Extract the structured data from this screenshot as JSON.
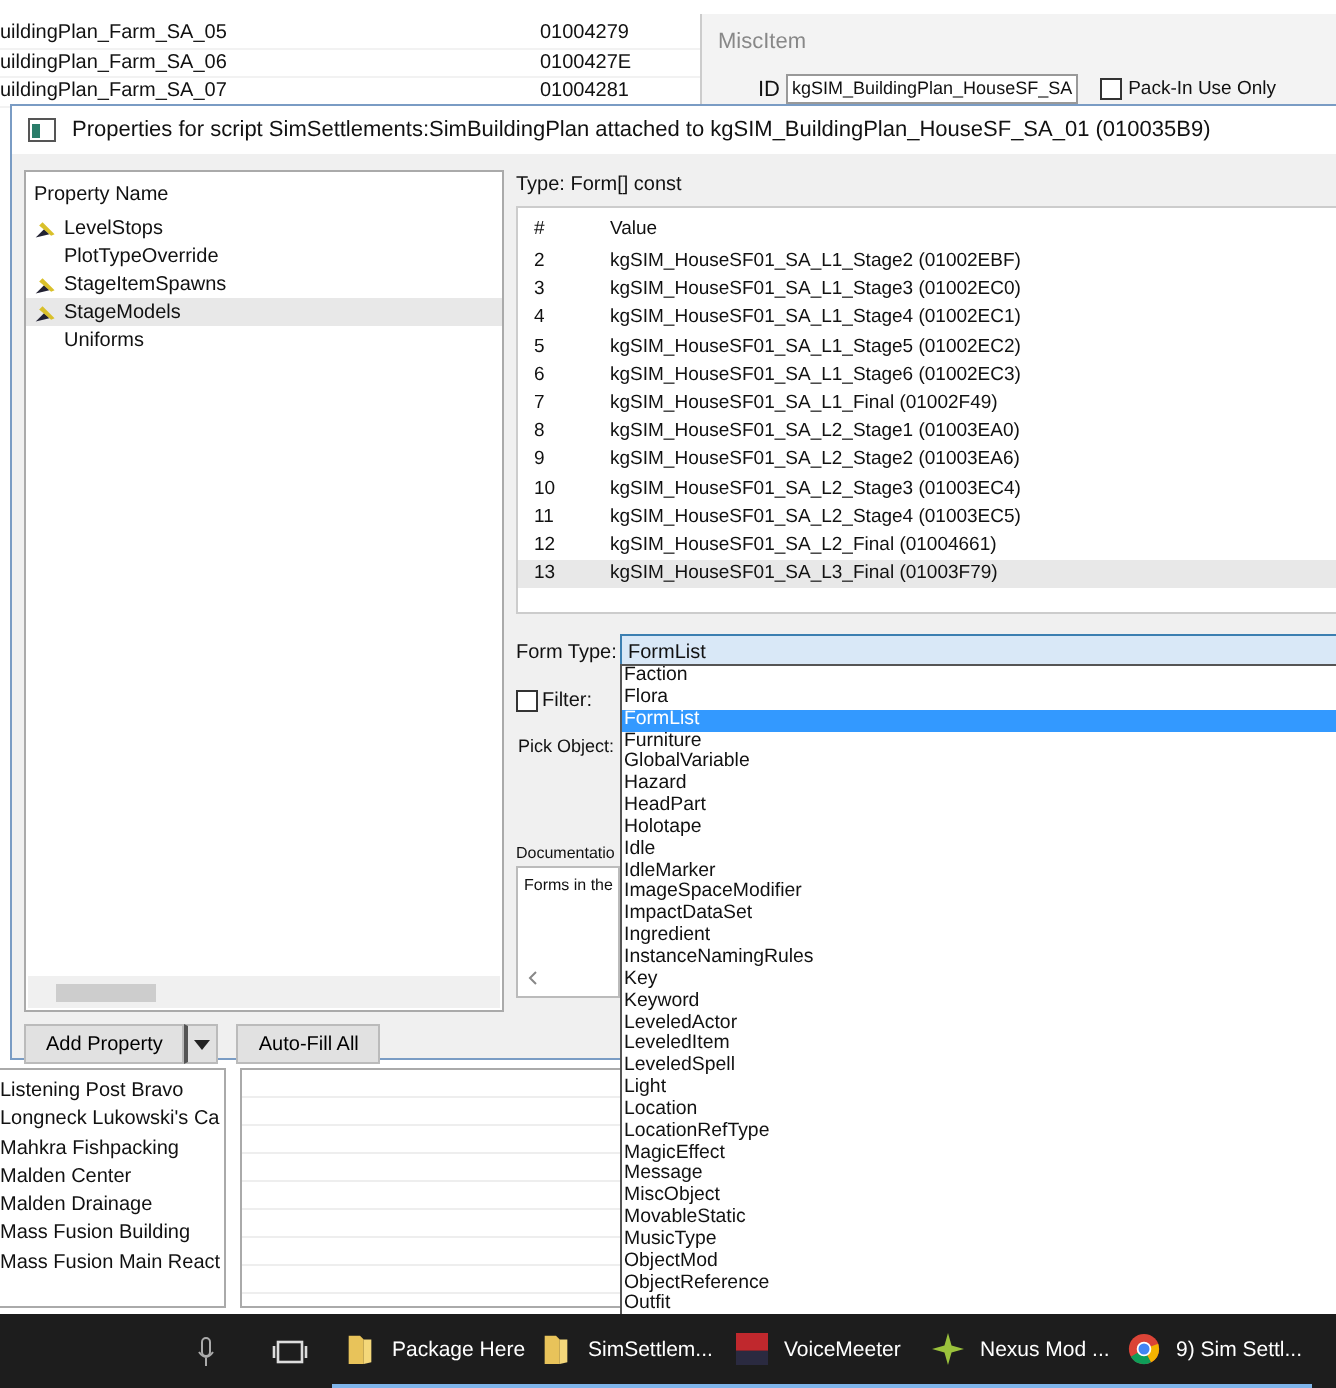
{
  "back_list": {
    "rows": [
      {
        "name": "uildingPlan_Farm_SA_05",
        "form_id": "01004279"
      },
      {
        "name": "uildingPlan_Farm_SA_06",
        "form_id": "0100427E"
      },
      {
        "name": "uildingPlan_Farm_SA_07",
        "form_id": "01004281"
      }
    ]
  },
  "misc_item": {
    "title": "MiscItem",
    "id_label": "ID",
    "id_value": "kgSIM_BuildingPlan_HouseSF_SA",
    "pack_in": {
      "label": "Pack-In Use Only",
      "checked": false
    }
  },
  "dialog": {
    "title": "Properties for script SimSettlements:SimBuildingPlan attached to kgSIM_BuildingPlan_HouseSF_SA_01 (010035B9)",
    "property_list": {
      "header": "Property Name",
      "items": [
        {
          "label": "LevelStops",
          "icon": true,
          "selected": false
        },
        {
          "label": "PlotTypeOverride",
          "icon": false,
          "selected": false
        },
        {
          "label": "StageItemSpawns",
          "icon": true,
          "selected": false
        },
        {
          "label": "StageModels",
          "icon": true,
          "selected": true
        },
        {
          "label": "Uniforms",
          "icon": false,
          "selected": false
        }
      ]
    },
    "add_property": "Add Property",
    "auto_fill": "Auto-Fill All",
    "type_label": "Type: Form[] const",
    "table": {
      "columns": [
        "#",
        "Value"
      ],
      "rows": [
        {
          "index": "2",
          "value": "kgSIM_HouseSF01_SA_L1_Stage2 (01002EBF)",
          "selected": false
        },
        {
          "index": "3",
          "value": "kgSIM_HouseSF01_SA_L1_Stage3 (01002EC0)",
          "selected": false
        },
        {
          "index": "4",
          "value": "kgSIM_HouseSF01_SA_L1_Stage4 (01002EC1)",
          "selected": false
        },
        {
          "index": "5",
          "value": "kgSIM_HouseSF01_SA_L1_Stage5 (01002EC2)",
          "selected": false
        },
        {
          "index": "6",
          "value": "kgSIM_HouseSF01_SA_L1_Stage6 (01002EC3)",
          "selected": false
        },
        {
          "index": "7",
          "value": "kgSIM_HouseSF01_SA_L1_Final (01002F49)",
          "selected": false
        },
        {
          "index": "8",
          "value": "kgSIM_HouseSF01_SA_L2_Stage1 (01003EA0)",
          "selected": false
        },
        {
          "index": "9",
          "value": "kgSIM_HouseSF01_SA_L2_Stage2 (01003EA6)",
          "selected": false
        },
        {
          "index": "10",
          "value": "kgSIM_HouseSF01_SA_L2_Stage3 (01003EC4)",
          "selected": false
        },
        {
          "index": "11",
          "value": "kgSIM_HouseSF01_SA_L2_Stage4 (01003EC5)",
          "selected": false
        },
        {
          "index": "12",
          "value": "kgSIM_HouseSF01_SA_L2_Final (01004661)",
          "selected": false
        },
        {
          "index": "13",
          "value": "kgSIM_HouseSF01_SA_L3_Final (01003F79)",
          "selected": true
        }
      ]
    },
    "form_type": {
      "label": "Form Type:",
      "value": "FormList",
      "options": [
        {
          "label": "Faction",
          "selected": false
        },
        {
          "label": "Flora",
          "selected": false
        },
        {
          "label": "FormList",
          "selected": true
        },
        {
          "label": "Furniture",
          "selected": false
        },
        {
          "label": "GlobalVariable",
          "selected": false
        },
        {
          "label": "Hazard",
          "selected": false
        },
        {
          "label": "HeadPart",
          "selected": false
        },
        {
          "label": "Holotape",
          "selected": false
        },
        {
          "label": "Idle",
          "selected": false
        },
        {
          "label": "IdleMarker",
          "selected": false
        },
        {
          "label": "ImageSpaceModifier",
          "selected": false
        },
        {
          "label": "ImpactDataSet",
          "selected": false
        },
        {
          "label": "Ingredient",
          "selected": false
        },
        {
          "label": "InstanceNamingRules",
          "selected": false
        },
        {
          "label": "Key",
          "selected": false
        },
        {
          "label": "Keyword",
          "selected": false
        },
        {
          "label": "LeveledActor",
          "selected": false
        },
        {
          "label": "LeveledItem",
          "selected": false
        },
        {
          "label": "LeveledSpell",
          "selected": false
        },
        {
          "label": "Light",
          "selected": false
        },
        {
          "label": "Location",
          "selected": false
        },
        {
          "label": "LocationRefType",
          "selected": false
        },
        {
          "label": "MagicEffect",
          "selected": false
        },
        {
          "label": "Message",
          "selected": false
        },
        {
          "label": "MiscObject",
          "selected": false
        },
        {
          "label": "MovableStatic",
          "selected": false
        },
        {
          "label": "MusicType",
          "selected": false
        },
        {
          "label": "ObjectMod",
          "selected": false
        },
        {
          "label": "ObjectReference",
          "selected": false
        },
        {
          "label": "Outfit",
          "selected": false
        }
      ]
    },
    "filter": {
      "label": "Filter:",
      "checked": false
    },
    "pick_object": "Pick Object:",
    "documentation": {
      "label": "Documentatio",
      "text": "Forms in the"
    }
  },
  "locations": {
    "items": [
      "Listening Post Bravo",
      "Longneck Lukowski's Ca",
      "Mahkra Fishpacking",
      "Malden Center",
      "Malden Drainage",
      "Mass Fusion Building",
      "Mass Fusion Main React"
    ]
  },
  "taskbar": {
    "apps": [
      {
        "label": "Package Here",
        "kind": "folder"
      },
      {
        "label": "SimSettlem...",
        "kind": "folder"
      },
      {
        "label": "VoiceMeeter",
        "kind": "mixer"
      },
      {
        "label": "Nexus Mod ...",
        "kind": "nexus"
      },
      {
        "label": "9) Sim Settl...",
        "kind": "browser"
      }
    ]
  }
}
